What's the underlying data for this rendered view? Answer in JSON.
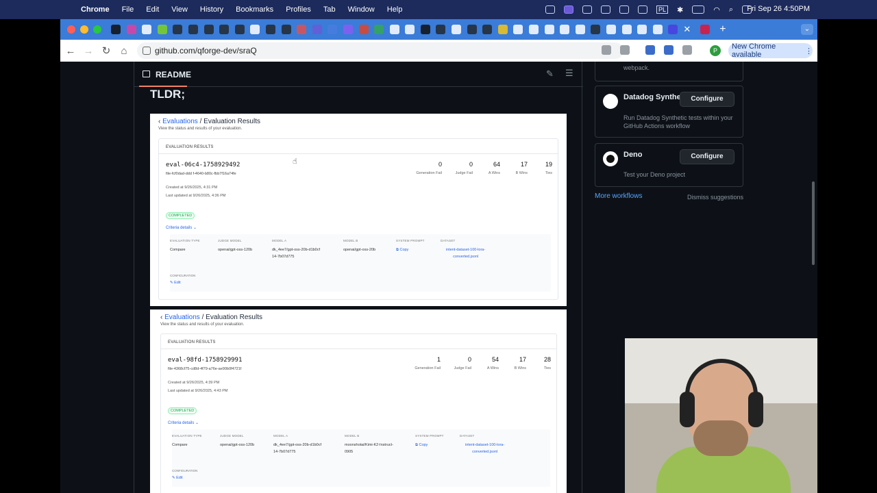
{
  "menubar": {
    "app": "Chrome",
    "items": [
      "File",
      "Edit",
      "View",
      "History",
      "Bookmarks",
      "Profiles",
      "Tab",
      "Window",
      "Help"
    ],
    "clock": "Fri Sep 26  4:50PM",
    "status_label": "PL"
  },
  "toolbar": {
    "url": "github.com/qforge-dev/sraQ",
    "new_chrome": "New Chrome available",
    "avatar_initial": "P"
  },
  "readme": {
    "title": "README",
    "heading": "TLDR;"
  },
  "evals": [
    {
      "breadcrumb_link": "Evaluations",
      "breadcrumb_current": "Evaluation Results",
      "subtitle": "View the status and results of your evaluation.",
      "card_title": "EVALUATION RESULTS",
      "eval_id": "eval-06c4-1758929492",
      "file_id": "file-fcf0dad-ddd f-4640-b80c-fbb7f16a74fe",
      "created": "Created at 9/26/2025, 4:31 PM",
      "updated": "Last updated at 9/26/2025, 4:36 PM",
      "status": "COMPLETED",
      "criteria": "Criteria details",
      "stats": [
        {
          "value": "0",
          "label": "Generation Fail"
        },
        {
          "value": "0",
          "label": "Judge Fail"
        },
        {
          "value": "64",
          "label": "A Wins"
        },
        {
          "value": "17",
          "label": "B Wins"
        },
        {
          "value": "19",
          "label": "Ties"
        }
      ],
      "details": {
        "eval_type_h": "EVALUATION TYPE",
        "eval_type": "Compare",
        "judge_h": "JUDGE MODEL",
        "judge": "openai/gpt-oss-120b",
        "model_a_h": "MODEL A",
        "model_a": "dk_4ee7/gpt-oss-20b-d1b0cf\n14-7b07d775",
        "model_b_h": "MODEL B",
        "model_b": "openai/gpt-oss-20b",
        "prompt_h": "SYSTEM PROMPT",
        "prompt": "Copy",
        "dataset_h": "DATASET",
        "dataset": "intent-dataset-100-lora-\nconverted.jsonl",
        "config_h": "CONFIGURATION",
        "edit": "Edit"
      }
    },
    {
      "breadcrumb_link": "Evaluations",
      "breadcrumb_current": "Evaluation Results",
      "subtitle": "View the status and results of your evaluation.",
      "card_title": "EVALUATION RESULTS",
      "eval_id": "eval-98fd-1758929991",
      "file_id": "file-4368cf75-cd8d-4f79-a76e-ae90b0f4721f",
      "created": "Created at 9/26/2025, 4:39 PM",
      "updated": "Last updated at 9/26/2025, 4:43 PM",
      "status": "COMPLETED",
      "criteria": "Criteria details",
      "stats": [
        {
          "value": "1",
          "label": "Generation Fail"
        },
        {
          "value": "0",
          "label": "Judge Fail"
        },
        {
          "value": "54",
          "label": "A Wins"
        },
        {
          "value": "17",
          "label": "B Wins"
        },
        {
          "value": "28",
          "label": "Ties"
        }
      ],
      "details": {
        "eval_type_h": "EVALUATION TYPE",
        "eval_type": "Compare",
        "judge_h": "JUDGE MODEL",
        "judge": "openai/gpt-oss-120b",
        "model_a_h": "MODEL A",
        "model_a": "dk_4ee7/gpt-oss-20b-d1b0cf\n14-7b07d775",
        "model_b_h": "MODEL B",
        "model_b": "moonshotai/Kimi-K2-Instruct-\n0905",
        "prompt_h": "SYSTEM PROMPT",
        "prompt": "Copy",
        "dataset_h": "DATASET",
        "dataset": "intent-dataset-100-lora-\nconverted.jsonl",
        "config_h": "CONFIGURATION",
        "edit": "Edit"
      }
    }
  ],
  "sidebar": {
    "top_desc": "webpack.",
    "workflows": [
      {
        "name": "Datadog Synthetics",
        "button": "Configure",
        "desc": "Run Datadog Synthetic tests within your GitHub Actions workflow"
      },
      {
        "name": "Deno",
        "button": "Configure",
        "desc": "Test your Deno project"
      }
    ],
    "more": "More workflows",
    "dismiss": "Dismiss suggestions"
  },
  "colors": {
    "accent": "#58a6ff",
    "tab_strip": "#3a7cd8",
    "page_bg": "#0d1117"
  }
}
